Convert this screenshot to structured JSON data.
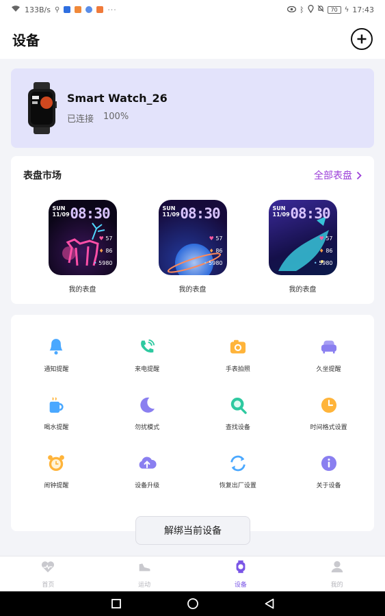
{
  "statusbar": {
    "speed": "133B/s",
    "battery": "70",
    "time": "17:43"
  },
  "header": {
    "title": "设备",
    "add_icon": "plus-circle-icon"
  },
  "device": {
    "name": "Smart Watch_26",
    "status": "已连接",
    "battery": "100%"
  },
  "dial_market": {
    "title": "表盘市场",
    "all_label": "全部表盘",
    "dials": [
      {
        "label": "我的表盘",
        "day": "SUN",
        "date": "11/09",
        "time": "08:30",
        "hr": "57",
        "cal": "86",
        "steps": "5980",
        "theme": "deer"
      },
      {
        "label": "我的表盘",
        "day": "SUN",
        "date": "11/09",
        "time": "08:30",
        "hr": "57",
        "cal": "86",
        "steps": "5980",
        "theme": "planet"
      },
      {
        "label": "我的表盘",
        "day": "SUN",
        "date": "11/09",
        "time": "08:30",
        "hr": "57",
        "cal": "86",
        "steps": "5980",
        "theme": "whale"
      }
    ]
  },
  "features": [
    {
      "label": "通知提醒",
      "icon": "bell-icon",
      "color": "#4aa8ff"
    },
    {
      "label": "来电提醒",
      "icon": "phone-icon",
      "color": "#2ec9a0"
    },
    {
      "label": "手表拍照",
      "icon": "camera-icon",
      "color": "#ffb43a"
    },
    {
      "label": "久坐提醒",
      "icon": "sofa-icon",
      "color": "#8a7ff0"
    },
    {
      "label": "喝水提醒",
      "icon": "cup-icon",
      "color": "#4aa8ff"
    },
    {
      "label": "勿扰模式",
      "icon": "moon-icon",
      "color": "#8a7ff0"
    },
    {
      "label": "查找设备",
      "icon": "search-icon",
      "color": "#2ec9a0"
    },
    {
      "label": "时间格式设置",
      "icon": "clock-icon",
      "color": "#ffb43a"
    },
    {
      "label": "闹钟提醒",
      "icon": "alarm-icon",
      "color": "#ffb43a"
    },
    {
      "label": "设备升级",
      "icon": "cloud-upload-icon",
      "color": "#8a7ff0"
    },
    {
      "label": "恢复出厂设置",
      "icon": "reset-icon",
      "color": "#4aa8ff"
    },
    {
      "label": "关于设备",
      "icon": "info-icon",
      "color": "#8a7ff0"
    }
  ],
  "unbind_label": "解绑当前设备",
  "tabs": [
    {
      "label": "首页",
      "icon": "heart-icon",
      "active": false
    },
    {
      "label": "运动",
      "icon": "shoe-icon",
      "active": false
    },
    {
      "label": "设备",
      "icon": "watch-icon",
      "active": true
    },
    {
      "label": "我的",
      "icon": "user-icon",
      "active": false
    }
  ],
  "colors": {
    "accent": "#9b3fd8",
    "device_card": "#e3e3fb",
    "active_tab": "#7a55e6"
  }
}
